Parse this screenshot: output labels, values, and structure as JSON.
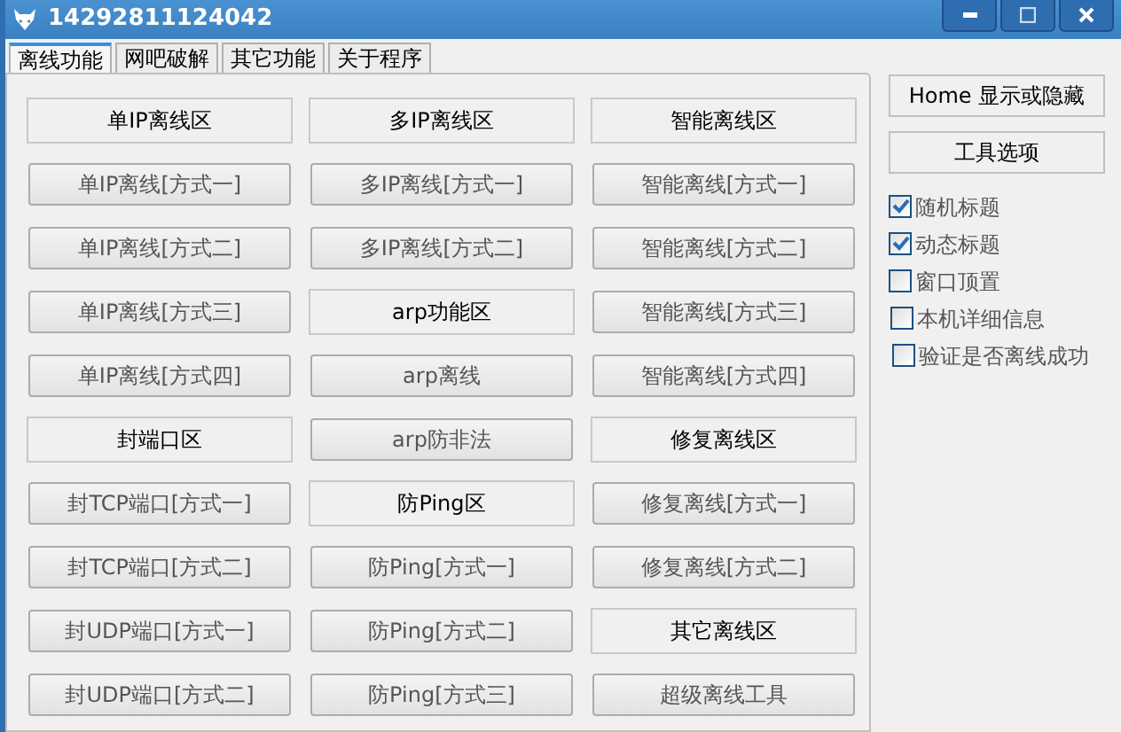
{
  "window": {
    "title": "14292811124042"
  },
  "tabs": [
    {
      "label": "离线功能",
      "selected": true
    },
    {
      "label": "网吧破解",
      "selected": false
    },
    {
      "label": "其它功能",
      "selected": false
    },
    {
      "label": "关于程序",
      "selected": false
    }
  ],
  "grid": [
    [
      {
        "kind": "header",
        "label": "单IP离线区"
      },
      {
        "kind": "header",
        "label": "多IP离线区"
      },
      {
        "kind": "header",
        "label": "智能离线区"
      }
    ],
    [
      {
        "kind": "button",
        "label": "单IP离线[方式一]"
      },
      {
        "kind": "button",
        "label": "多IP离线[方式一]"
      },
      {
        "kind": "button",
        "label": "智能离线[方式一]"
      }
    ],
    [
      {
        "kind": "button",
        "label": "单IP离线[方式二]"
      },
      {
        "kind": "button",
        "label": "多IP离线[方式二]"
      },
      {
        "kind": "button",
        "label": "智能离线[方式二]"
      }
    ],
    [
      {
        "kind": "button",
        "label": "单IP离线[方式三]"
      },
      {
        "kind": "header",
        "label": "arp功能区"
      },
      {
        "kind": "button",
        "label": "智能离线[方式三]"
      }
    ],
    [
      {
        "kind": "button",
        "label": "单IP离线[方式四]"
      },
      {
        "kind": "button",
        "label": "arp离线"
      },
      {
        "kind": "button",
        "label": "智能离线[方式四]"
      }
    ],
    [
      {
        "kind": "header",
        "label": "封端口区"
      },
      {
        "kind": "button",
        "label": "arp防非法"
      },
      {
        "kind": "header",
        "label": "修复离线区"
      }
    ],
    [
      {
        "kind": "button",
        "label": "封TCP端口[方式一]"
      },
      {
        "kind": "header",
        "label": "防Ping区"
      },
      {
        "kind": "button",
        "label": "修复离线[方式一]"
      }
    ],
    [
      {
        "kind": "button",
        "label": "封TCP端口[方式二]"
      },
      {
        "kind": "button",
        "label": "防Ping[方式一]"
      },
      {
        "kind": "button",
        "label": "修复离线[方式二]"
      }
    ],
    [
      {
        "kind": "button",
        "label": "封UDP端口[方式一]"
      },
      {
        "kind": "button",
        "label": "防Ping[方式二]"
      },
      {
        "kind": "header",
        "label": "其它离线区"
      }
    ],
    [
      {
        "kind": "button",
        "label": "封UDP端口[方式二]"
      },
      {
        "kind": "button",
        "label": "防Ping[方式三]"
      },
      {
        "kind": "button",
        "label": "超级离线工具"
      }
    ]
  ],
  "side_panel": {
    "toggle_button": "Home 显示或隐藏",
    "options_header": "工具选项",
    "options": [
      {
        "label": "随机标题",
        "checked": true
      },
      {
        "label": "动态标题",
        "checked": true
      },
      {
        "label": "窗口顶置",
        "checked": false
      },
      {
        "label": "本机详细信息",
        "checked": false
      },
      {
        "label": "验证是否离线成功",
        "checked": false
      }
    ]
  }
}
